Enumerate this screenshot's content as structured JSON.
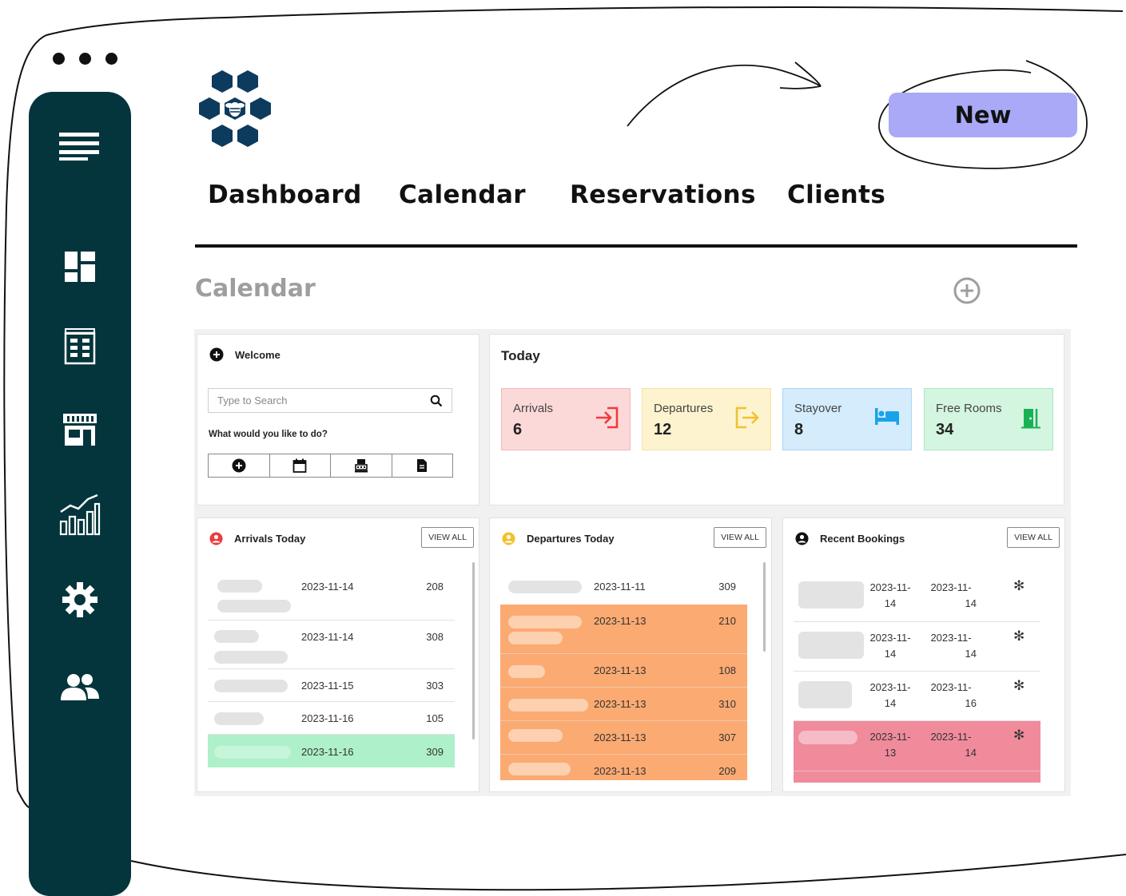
{
  "brand": {
    "logo_name": "bee-hive-logo"
  },
  "nav": {
    "items": [
      "Dashboard",
      "Calendar",
      "Reservations",
      "Clients"
    ]
  },
  "actions": {
    "new_label": "New"
  },
  "page": {
    "title": "Calendar"
  },
  "welcome": {
    "title": "Welcome",
    "search_placeholder": "Type to Search",
    "prompt": "What would you like to do?"
  },
  "today": {
    "title": "Today",
    "stats": [
      {
        "label": "Arrivals",
        "value": "6",
        "bg": "#fbd9d9",
        "border": "#f5b7b7",
        "icon_color": "#ef3b3b",
        "icon": "login-icon"
      },
      {
        "label": "Departures",
        "value": "12",
        "bg": "#fdf3cf",
        "border": "#f4e3a6",
        "icon_color": "#f2c12e",
        "icon": "logout-icon"
      },
      {
        "label": "Stayover",
        "value": "8",
        "bg": "#d4ecfb",
        "border": "#a9d7f3",
        "icon_color": "#1aa3e8",
        "icon": "bed-icon"
      },
      {
        "label": "Free Rooms",
        "value": "34",
        "bg": "#d4f5df",
        "border": "#a9e7bd",
        "icon_color": "#18b255",
        "icon": "door-icon"
      }
    ]
  },
  "arrivals": {
    "title": "Arrivals Today",
    "view_all": "VIEW ALL",
    "rows": [
      {
        "date": "2023-11-14",
        "room": "208",
        "highlight": ""
      },
      {
        "date": "2023-11-14",
        "room": "308",
        "highlight": ""
      },
      {
        "date": "2023-11-15",
        "room": "303",
        "highlight": ""
      },
      {
        "date": "2023-11-16",
        "room": "105",
        "highlight": ""
      },
      {
        "date": "2023-11-16",
        "room": "309",
        "highlight": "#aef0c9"
      }
    ]
  },
  "departures": {
    "title": "Departures Today",
    "view_all": "VIEW ALL",
    "rows": [
      {
        "date": "2023-11-11",
        "room": "309",
        "highlight": ""
      },
      {
        "date": "2023-11-13",
        "room": "210",
        "highlight": "#fbaa72"
      },
      {
        "date": "2023-11-13",
        "room": "108",
        "highlight": "#fbaa72"
      },
      {
        "date": "2023-11-13",
        "room": "310",
        "highlight": "#fbaa72"
      },
      {
        "date": "2023-11-13",
        "room": "307",
        "highlight": "#fbaa72"
      },
      {
        "date": "2023-11-13",
        "room": "209",
        "highlight": "#fbaa72"
      }
    ]
  },
  "bookings": {
    "title": "Recent Bookings",
    "view_all": "VIEW ALL",
    "rows": [
      {
        "from_a": "2023-11-",
        "from_b": "14",
        "to_a": "2023-11-",
        "to_b": "14",
        "mark": "✻",
        "highlight": ""
      },
      {
        "from_a": "2023-11-",
        "from_b": "14",
        "to_a": "2023-11-",
        "to_b": "14",
        "mark": "✻",
        "highlight": ""
      },
      {
        "from_a": "2023-11-",
        "from_b": "14",
        "to_a": "2023-11-",
        "to_b": "16",
        "mark": "✻",
        "highlight": ""
      },
      {
        "from_a": "2023-11-",
        "from_b": "13",
        "to_a": "2023-11-",
        "to_b": "14",
        "mark": "✻",
        "highlight": "#f08b9c"
      }
    ]
  },
  "colors": {
    "sidebar": "#05353c",
    "new_button": "#a9a9f7",
    "logo": "#0d3b5e"
  }
}
